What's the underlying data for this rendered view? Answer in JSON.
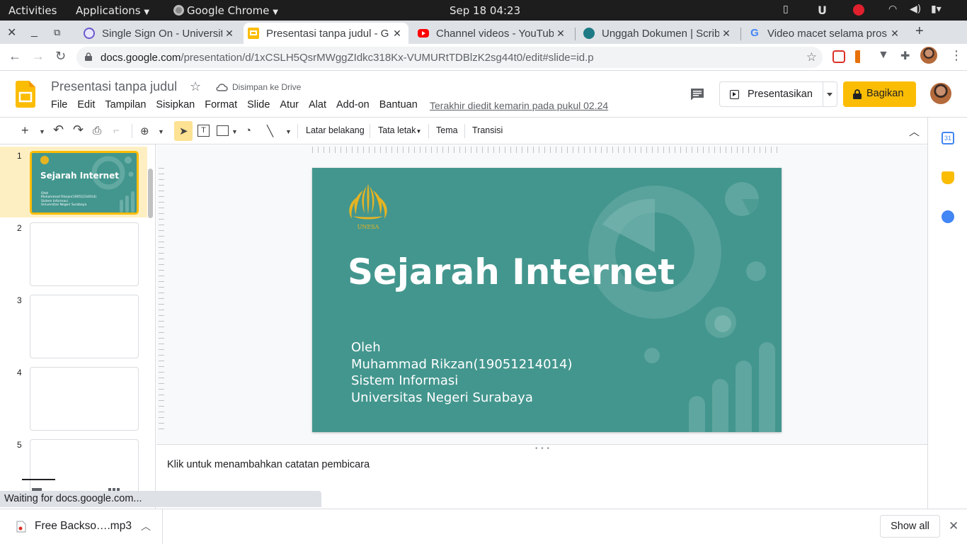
{
  "system_bar": {
    "activities": "Activities",
    "applications": "Applications",
    "app_name": "Google Chrome",
    "datetime": "Sep 18  04:23"
  },
  "tabs": [
    {
      "title": "Single Sign On - Universit",
      "favicon": "sso-icon",
      "active": false
    },
    {
      "title": "Presentasi tanpa judul - G",
      "favicon": "slides-icon",
      "active": true
    },
    {
      "title": "Channel videos - YouTube",
      "favicon": "youtube-icon",
      "active": false
    },
    {
      "title": "Unggah Dokumen | Scribd",
      "favicon": "scribd-icon",
      "active": false
    },
    {
      "title": "Video macet selama pros",
      "favicon": "google-icon",
      "active": false
    }
  ],
  "address_bar": {
    "host": "docs.google.com",
    "path": "/presentation/d/1xCSLH5QsrMWggZIdkc318Kx-VUMURtTDBlzK2sg44t0/edit#slide=id.p"
  },
  "doc": {
    "title": "Presentasi tanpa judul",
    "saved_status": "Disimpan ke Drive",
    "last_edit": "Terakhir diedit kemarin pada pukul 02.24",
    "present_label": "Presentasikan",
    "share_label": "Bagikan"
  },
  "menu": [
    "File",
    "Edit",
    "Tampilan",
    "Sisipkan",
    "Format",
    "Slide",
    "Atur",
    "Alat",
    "Add-on",
    "Bantuan"
  ],
  "toolbar": {
    "background": "Latar belakang",
    "layout": "Tata letak",
    "theme": "Tema",
    "transition": "Transisi"
  },
  "slides": [
    {
      "number": "1",
      "selected": true
    },
    {
      "number": "2",
      "selected": false
    },
    {
      "number": "3",
      "selected": false
    },
    {
      "number": "4",
      "selected": false
    },
    {
      "number": "5",
      "selected": false
    }
  ],
  "slide_content": {
    "logo_text": "UNESA",
    "title": "Sejarah Internet",
    "body": [
      "Oleh",
      "Muhammad Rikzan(19051214014)",
      "Sistem Informasi",
      "Universitas Negeri Surabaya"
    ]
  },
  "thumb1": {
    "title": "Sejarah Internet",
    "body": [
      "Oleh",
      "Muhammad Rikzan(19051214014)",
      "Sistem Informasi",
      "Universitas Negeri Surabaya"
    ]
  },
  "notes_placeholder": "Klik untuk menambahkan catatan pembicara",
  "status_text": "Waiting for docs.google.com...",
  "downloads": {
    "file_name": "Free Backso….mp3",
    "show_all": "Show all"
  },
  "colors": {
    "slide_bg": "#43968e",
    "accent_yellow": "#fbbc04",
    "logo_gold": "#e6b422"
  }
}
